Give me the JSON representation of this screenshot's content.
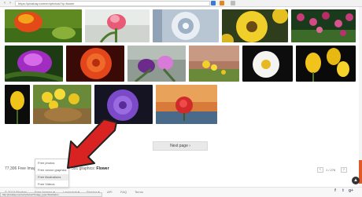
{
  "browser": {
    "url": "https://pixabay.com/en/photos/?q=flower",
    "back_glyph": "‹",
    "forward_glyph": "›"
  },
  "thumbnails": [
    {
      "name": "thumb-red-tulip"
    },
    {
      "name": "thumb-pink-tulip"
    },
    {
      "name": "thumb-frost-flower"
    },
    {
      "name": "thumb-yellow-daisy"
    },
    {
      "name": "thumb-pink-tulips-field"
    },
    {
      "name": "thumb-purple-tulip"
    },
    {
      "name": "thumb-orange-rose"
    },
    {
      "name": "thumb-purple-tulips"
    },
    {
      "name": "thumb-yellow-wildflowers"
    },
    {
      "name": "thumb-white-daisy"
    },
    {
      "name": "thumb-yellow-tulips"
    },
    {
      "name": "thumb-yellow-tulip-small"
    },
    {
      "name": "thumb-yellow-flower-basket"
    },
    {
      "name": "thumb-purple-aster"
    },
    {
      "name": "thumb-red-rose-water"
    }
  ],
  "pager": {
    "next_label": "Next page ›",
    "results_text": "77,306 Free Images",
    "vector_prefix": "591 graphics:",
    "vector_term": "Flower",
    "prev_glyph": "‹",
    "page_text": "1 / 276",
    "next_glyph": "›"
  },
  "dropdown": {
    "items": [
      "Free photos",
      "Free vector graphics",
      "Free illustrations",
      "Free Videos"
    ],
    "highlighted_index": 2
  },
  "footer": {
    "copyright": "© 2015 Pixabay",
    "free_images": "Free Images ▾",
    "language": "Language ▾",
    "service": "Service ▾",
    "api": "API",
    "faq": "FAQ",
    "terms": "Terms",
    "status_url": "http://pixabay.com/en/photos/?image_type=illustration"
  },
  "social": {
    "facebook": "f",
    "twitter": "t",
    "gplus": "g+"
  },
  "colors": {
    "accent": "#e05a28",
    "arrow": "#d92323"
  }
}
